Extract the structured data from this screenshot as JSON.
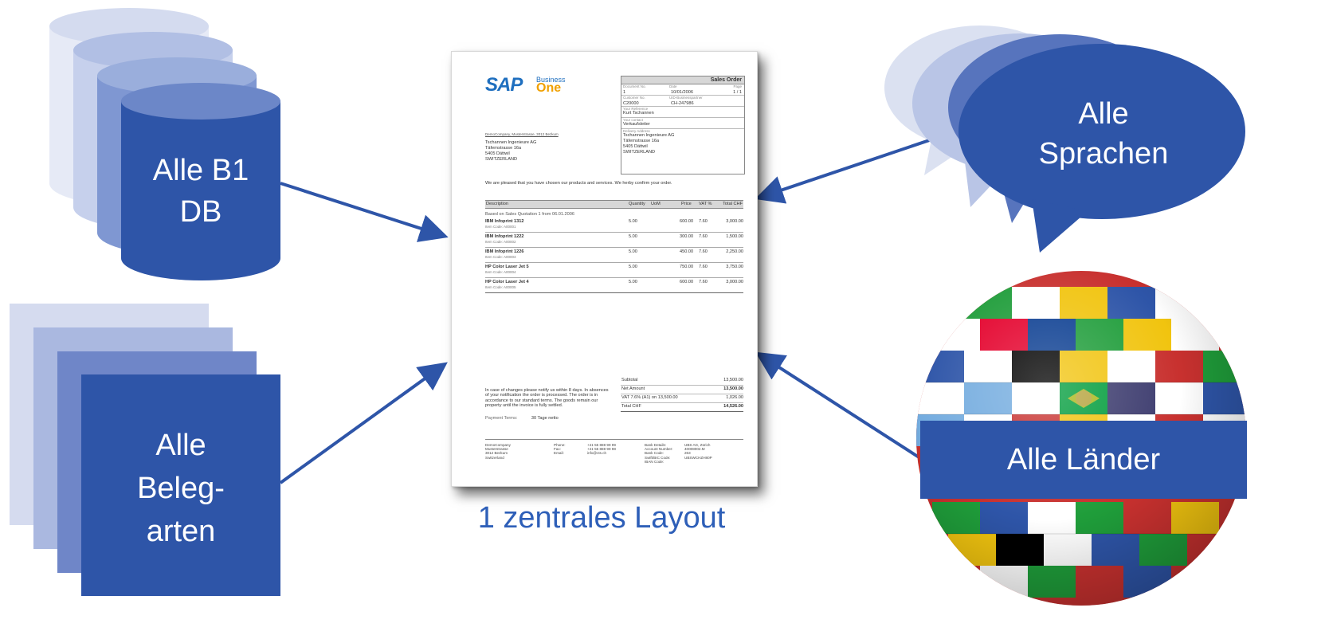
{
  "colors": {
    "primary_blue": "#2e55a8",
    "caption_blue": "#2e5fb8",
    "light_blue_1": "#d5dbef",
    "light_blue_2": "#aab8e0",
    "mid_blue": "#6f86c8"
  },
  "left": {
    "databases_label_line1": "Alle B1",
    "databases_label_line2": "DB",
    "doc_types_label_line1": "Alle",
    "doc_types_label_line2": "Beleg-",
    "doc_types_label_line3": "arten"
  },
  "right": {
    "languages_label_line1": "Alle",
    "languages_label_line2": "Sprachen",
    "countries_label": "Alle Länder"
  },
  "center": {
    "caption": "1 zentrales Layout"
  },
  "document": {
    "logo_sap": "SAP",
    "logo_business": "Business",
    "logo_one": "One",
    "title": "Sales Order",
    "doc_no_label": "Document No.",
    "date_label": "Date",
    "page_label": "Page",
    "doc_no": "1",
    "date": "10/01/2006",
    "page": "1 / 1",
    "customer_no_label": "Customer No.",
    "uid_label": "UID-Businesspartner",
    "customer_no": "C20000",
    "uid": "CH-247986",
    "your_reference_label": "Your Reference",
    "your_reference": "Kurt Tschannen",
    "your_contact_label": "Your contact",
    "your_contact": "Verkaufsleiter",
    "delivery_address_label": "Delivery Address",
    "delivery_address_1": "Tschannen Ingenieure AG",
    "delivery_address_2": "Täfernstrasse 16a",
    "delivery_address_3": "5405 Dättwil",
    "delivery_address_4": "SWITZERLAND",
    "sender_line": "DemoCompany, Musterstrasse, 3012 Bezkum",
    "address_1": "Tschannen Ingenieure AG",
    "address_2": "Täfernstrasse 16a",
    "address_3": "5405 Dättwil",
    "address_4": "SWITZERLAND",
    "intro": "We are pleased that you have chosen our products and services. We herby confirm your order.",
    "col_description": "Description",
    "col_quantity": "Quantity",
    "col_uom": "UoM",
    "col_price": "Price",
    "col_vat": "VAT %",
    "col_total": "Total CHF",
    "based_on": "Based on Sales Quotation 1 from 06.01.2006",
    "items": [
      {
        "name": "IBM Infoprint 1312",
        "sub": "Item Code: A00001",
        "qty": "5.00",
        "price": "600.00",
        "vat": "7.60",
        "total": "3,000.00"
      },
      {
        "name": "IBM Infoprint 1222",
        "sub": "Item Code: A00002",
        "qty": "5.00",
        "price": "300.00",
        "vat": "7.60",
        "total": "1,500.00"
      },
      {
        "name": "IBM Infoprint 1226",
        "sub": "Item Code: A00003",
        "qty": "5.00",
        "price": "450.00",
        "vat": "7.60",
        "total": "2,250.00"
      },
      {
        "name": "HP Color Laser Jet 5",
        "sub": "Item Code: A00004",
        "qty": "5.00",
        "price": "750.00",
        "vat": "7.60",
        "total": "3,750.00"
      },
      {
        "name": "HP Color Laser Jet 4",
        "sub": "Item Code: A00005",
        "qty": "5.00",
        "price": "600.00",
        "vat": "7.60",
        "total": "3,000.00"
      }
    ],
    "subtotal_label": "Subtotal",
    "subtotal": "13,500.00",
    "net_label": "Net Amount",
    "net": "13,500.00",
    "vat_label": "VAT 7.6% (A1) on 13,500.00",
    "vat": "1,026.00",
    "total_label": "Total CHF",
    "total": "14,526.00",
    "notice": "In case of changes please notify us within 8 days. In absences of your notification the order is processed. The order is in accordance to our standard terms. The goods remain our property until the invoice is fully settled.",
    "payment_terms_label": "Payment Terms:",
    "payment_terms": "30 Tage netto",
    "footer_col1": "DemoCompany\nMusterstrasse\n3012 Bezkum\nSwitzerland",
    "footer_col2": "Phone:\nFax:\nEmail:",
    "footer_col3": "+41 55 888 99 99\n+41 55 888 99 98\ninfo@cts.ch",
    "footer_col4": "Bank Details:\nAccount Number:\nBank Code:\nSwift/BIC Code:\nIBAN Code:",
    "footer_col5": "UBS AG, Zürich\n40008002.M\n263\nUBSWCHZH80P"
  }
}
